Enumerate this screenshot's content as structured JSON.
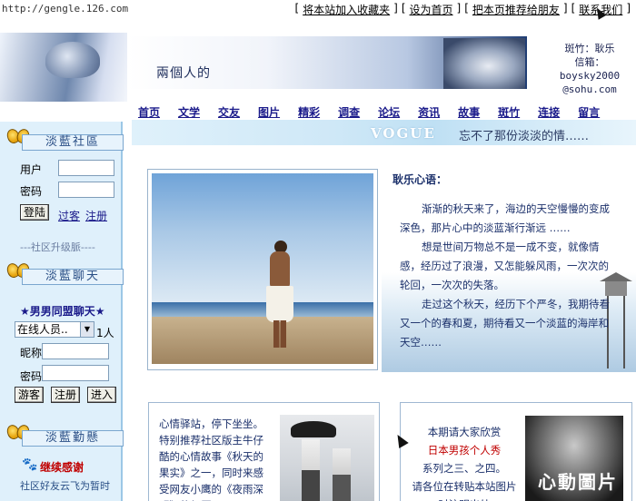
{
  "topbar": {
    "url": "http://gengle.126.com",
    "links": [
      "将本站加入收藏夹",
      "设为首页",
      "把本页推荐给朋友",
      "联系我们"
    ]
  },
  "header": {
    "subtitle": "兩個人的",
    "contact_line1": "斑竹：耿乐",
    "contact_line2": "信箱：boysky2000",
    "contact_line3": "@sohu.com"
  },
  "nav": {
    "items": [
      "首页",
      "文学",
      "交友",
      "图片",
      "精彩",
      "调查",
      "论坛",
      "资讯",
      "故事",
      "斑竹",
      "连接",
      "留言"
    ],
    "banner_word": "VOGUE",
    "tagline": "忘不了那份淡淡的情……"
  },
  "sidebar": {
    "community_title": "淡藍社區",
    "user_label": "用户",
    "password_label": "密码",
    "login_button": "登陆",
    "guest_link": "过客",
    "register_link": "注册",
    "upgrade_text": "---社区升级脈----",
    "chat_title": "淡藍聊天",
    "chat_banner": "★男男同盟聊天★",
    "online_select": "在线人员..",
    "online_count": "1人",
    "nickname_label": "昵称",
    "chat_password_label": "密码",
    "guest_button": "游客",
    "register_button": "注册",
    "enter_button": "进入",
    "thanks_title": "淡藍勤懸",
    "thanks_red": "继续感谢",
    "thanks_text": "社区好友云飞为暂时\n"
  },
  "main": {
    "mood_title": "耿乐心语：",
    "mood_paragraphs": [
      "渐渐的秋天来了，海边的天空慢慢的变成深色，那片心中的淡蓝渐行渐远 ……",
      "想是世间万物总不是一成不变，就像情感，经历过了浪漫，又怎能躲风雨，一次次的轮回，一次次的失落。",
      "走过这个秋天，经历下个严冬，我期待看又一个的春和夏，期待看又一个淡蓝的海岸和天空……"
    ],
    "box1_text": "心情驿站，停下坐坐。特别推荐社区版主牛仔酷的心情故事《秋天的果实》之一，同时来感受网友小鹰的《夜雨深明》的经历。",
    "box1_special": "特别推荐",
    "box1_name1": "牛仔酷",
    "box2_line1": "本期请大家欣赏",
    "box2_red": "日本男孩个人秀",
    "box2_line2": "系列之三、之四。",
    "box2_line3": "请各位在转贴本站图片时注明出处",
    "box2_caption": "心動圖片"
  }
}
